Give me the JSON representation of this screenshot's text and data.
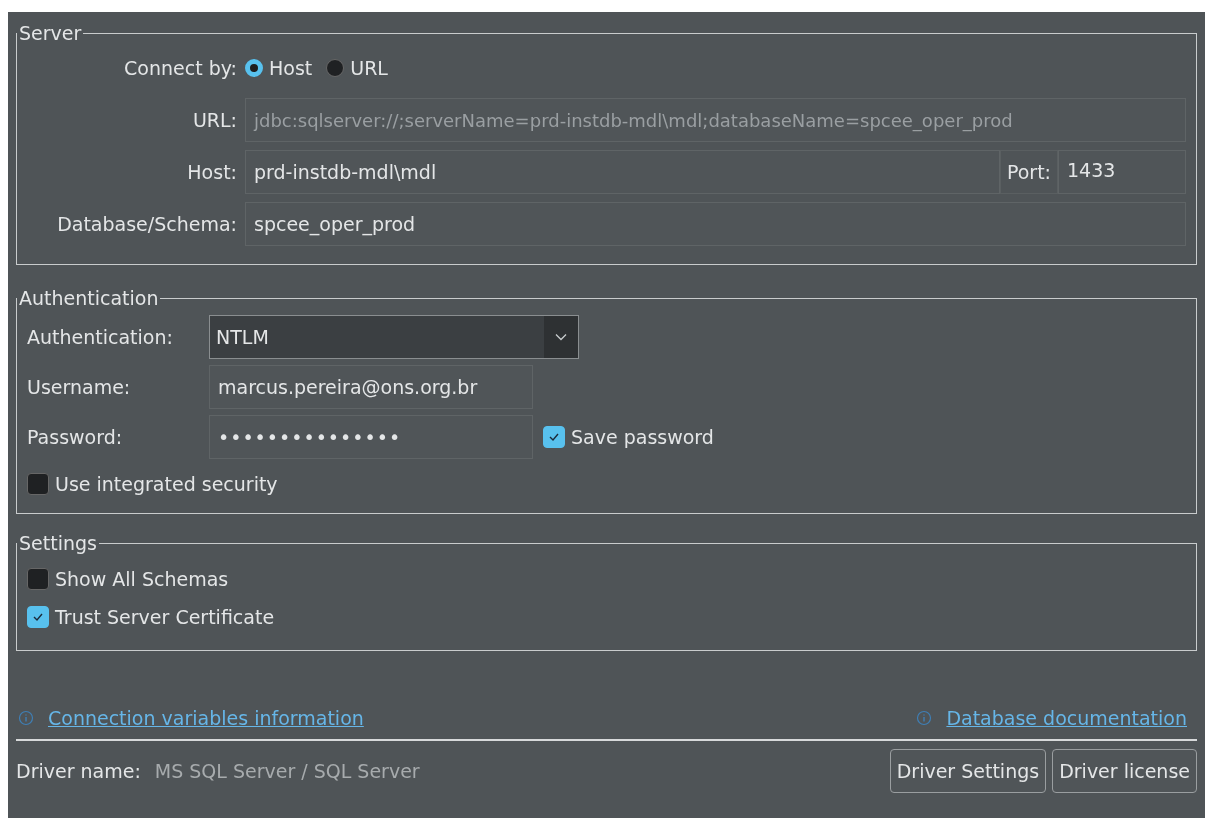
{
  "server": {
    "title": "Server",
    "connect_by": {
      "label": "Connect by:",
      "options": [
        {
          "label": "Host",
          "selected": true
        },
        {
          "label": "URL",
          "selected": false
        }
      ]
    },
    "url": {
      "label": "URL:",
      "value": "jdbc:sqlserver://;serverName=prd-instdb-mdl\\mdl;databaseName=spcee_oper_prod",
      "disabled": true
    },
    "host": {
      "label": "Host:",
      "value": "prd-instdb-mdl\\mdl"
    },
    "port": {
      "label": "Port:",
      "value": "1433"
    },
    "database": {
      "label": "Database/Schema:",
      "value": "spcee_oper_prod"
    }
  },
  "authentication": {
    "title": "Authentication",
    "method": {
      "label": "Authentication:",
      "value": "NTLM"
    },
    "username": {
      "label": "Username:",
      "value": "marcus.pereira@ons.org.br"
    },
    "password": {
      "label": "Password:",
      "value": "•••••••••••••••"
    },
    "save_password": {
      "label": "Save password",
      "checked": true
    },
    "integrated_security": {
      "label": "Use integrated security",
      "checked": false
    }
  },
  "settings": {
    "title": "Settings",
    "options": [
      {
        "label": "Show All Schemas",
        "checked": false
      },
      {
        "label": "Trust Server Certificate",
        "checked": true
      }
    ]
  },
  "links": [
    "Connection variables information",
    "Database documentation"
  ],
  "driver": {
    "label": "Driver name:",
    "value": "MS SQL Server / SQL Server"
  },
  "buttons": [
    "Driver Settings",
    "Driver license"
  ]
}
